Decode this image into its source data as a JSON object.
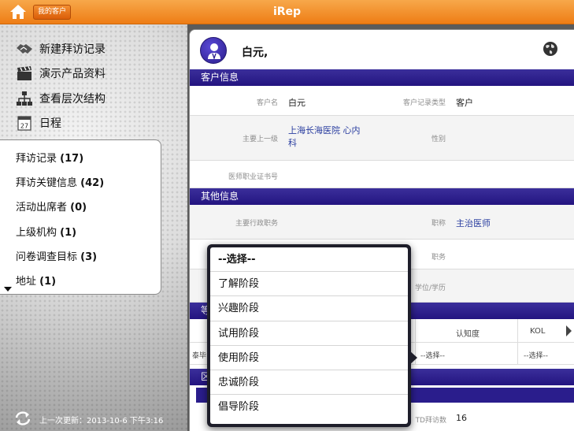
{
  "app": {
    "title": "iRep",
    "my_customers_label": "我的客户"
  },
  "sidebar": {
    "actions": [
      {
        "label": "新建拜访记录",
        "icon": "handshake-icon"
      },
      {
        "label": "演示产品资料",
        "icon": "clapperboard-icon"
      },
      {
        "label": "查看层次结构",
        "icon": "hierarchy-icon"
      },
      {
        "label": "日程",
        "icon": "calendar-icon",
        "calendar_day": "27"
      }
    ],
    "related": [
      {
        "label": "拜访记录",
        "count": "(17)"
      },
      {
        "label": "拜访关键信息",
        "count": "(42)"
      },
      {
        "label": "活动出席者",
        "count": "(0)"
      },
      {
        "label": "上级机构",
        "count": "(1)"
      },
      {
        "label": "问卷调查目标",
        "count": "(3)"
      },
      {
        "label": "地址",
        "count": "(1)"
      }
    ],
    "last_update": "上一次更新：2013-10-6 下午3:16"
  },
  "customer": {
    "name": "白元,",
    "sections": {
      "info": "客户信息",
      "other": "其他信息",
      "partial_a": "等",
      "partial_b": "区"
    },
    "fields": {
      "name_label": "客户名",
      "name_value": "白元",
      "record_type_label": "客户记录类型",
      "record_type_value": "客户",
      "parent_label": "主要上一级",
      "parent_value_line1": "上海长海医院 心内",
      "parent_value_line2": "科",
      "gender_label": "性别",
      "license_label": "医师职业证书号",
      "admin_title_label": "主要行政职务",
      "title_label": "职称",
      "title_value": "主治医师",
      "position_label": "职务",
      "degree_label": "学位/学历"
    },
    "table": {
      "col_awareness": "认知度",
      "col_kol": "KOL",
      "row_label": "泰毕",
      "awareness_value": "--选择--",
      "kol_value": "--选择--"
    },
    "ytd_label": "TD拜访数",
    "ytd_value": "16"
  },
  "dropdown": {
    "options": [
      "--选择--",
      "了解阶段",
      "兴趣阶段",
      "试用阶段",
      "使用阶段",
      "忠诚阶段",
      "倡导阶段"
    ],
    "selected": "--选择--"
  }
}
